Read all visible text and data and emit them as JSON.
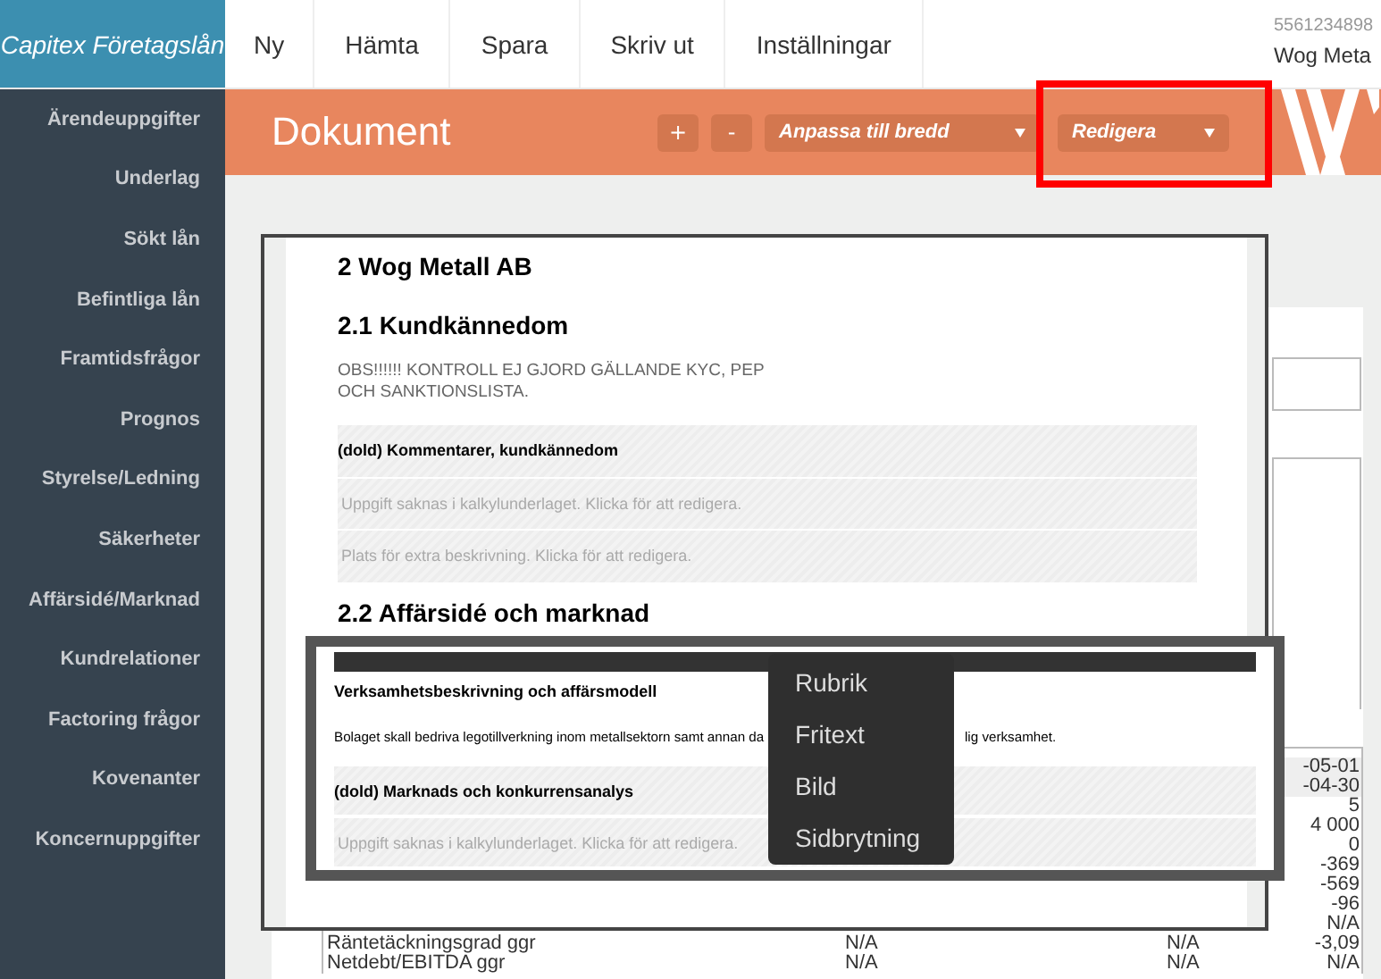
{
  "app_title": "Capitex Företagslån",
  "nav": [
    "Ny",
    "Hämta",
    "Spara",
    "Skriv ut",
    "Inställningar"
  ],
  "company": {
    "org_number": "5561234898",
    "name": "Wog Meta"
  },
  "toolbar": {
    "title": "Dokument",
    "buttons": [
      "+",
      "-"
    ],
    "zoom_select": "Anpassa till bredd",
    "mode_select": "Redigera"
  },
  "sidebar": {
    "items": [
      "Ärendeuppgifter",
      "Underlag",
      "Sökt lån",
      "Befintliga lån",
      "Framtidsfrågor",
      "Prognos",
      "Styrelse/Ledning",
      "Säkerheter",
      "Affärsidé/Marknad",
      "Kundrelationer",
      "Factoring frågor",
      "Kovenanter",
      "Koncernuppgifter"
    ]
  },
  "background": {
    "table": {
      "rows": [
        {
          "kind": "header",
          "column_4": "-05-01"
        },
        {
          "kind": "header",
          "column_4": "-04-30"
        },
        {
          "kind": "data",
          "column_4": "5"
        },
        {
          "kind": "data",
          "column_4": "4 000"
        },
        {
          "kind": "data",
          "column_4": "0"
        },
        {
          "kind": "data",
          "column_4": "-369"
        },
        {
          "kind": "data",
          "column_4": "-569"
        },
        {
          "kind": "data",
          "column_4": "-96"
        },
        {
          "kind": "data",
          "column_4": "N/A"
        },
        {
          "kind": "data",
          "label": "Räntetäckningsgrad ggr",
          "column_2": "N/A",
          "column_3": "N/A",
          "column_4": "-3,09"
        },
        {
          "kind": "data",
          "label": "Netdebt/EBITDA ggr",
          "column_2": "N/A",
          "column_3": "N/A",
          "column_4": "N/A"
        }
      ]
    }
  },
  "document": {
    "blocks": [
      {
        "kind": "title",
        "text": "2 Wog Metall AB"
      },
      {
        "kind": "section",
        "text": "2.1 Kundkännedom"
      },
      {
        "kind": "note",
        "text": "OBS!!!!!! KONTROLL EJ GJORD GÄLLANDE KYC, PEP\nOCH SANKTIONSLISTA."
      },
      {
        "kind": "hidden",
        "title": "(dold)  Kommentarer, kundkännedom",
        "fields": [
          "Uppgift saknas i kalkylunderlaget. Klicka för att redigera.",
          "Plats för extra beskrivning. Klicka för att redigera."
        ]
      },
      {
        "kind": "section",
        "text": "2.2 Affärsidé och marknad"
      }
    ],
    "selected_block": {
      "title": "Verksamhetsbeskrivning och affärsmodell",
      "text_before": "Bolaget skall bedriva legotillverkning inom metallsektorn samt annan da",
      "text_after": "lig verksamhet.",
      "hidden": {
        "title": "(dold)  Marknads och konkurrensanalys",
        "fields": [
          "Uppgift saknas i kalkylunderlaget. Klicka för att redigera."
        ]
      }
    }
  },
  "context_menu": {
    "items": [
      "Rubrik",
      "Fritext",
      "Bild",
      "Sidbrytning"
    ]
  }
}
